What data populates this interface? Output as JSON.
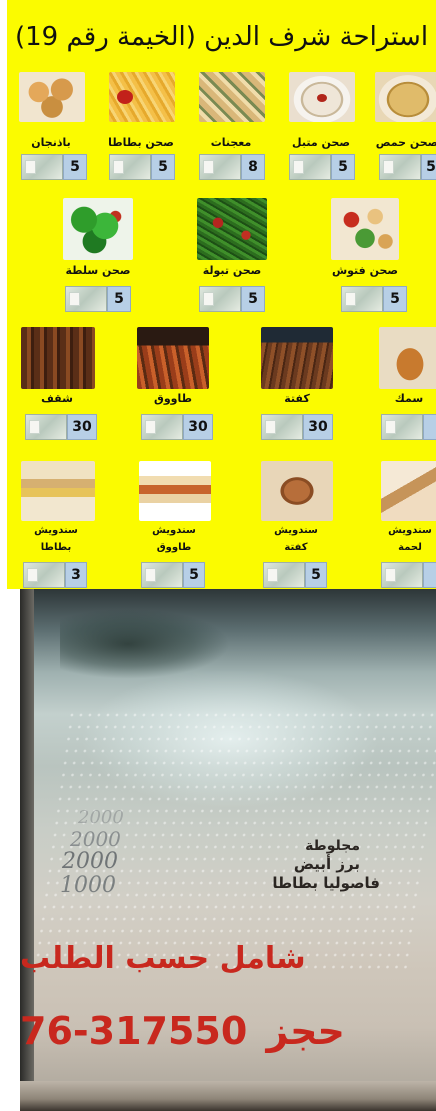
{
  "menu": {
    "title": "استراحة شرف الدين (الخيمة رقم 19)",
    "rows": [
      [
        {
          "label": "صحن حمص",
          "price": "5",
          "photo": "hummus"
        },
        {
          "label": "صحن متبل",
          "price": "5",
          "photo": "mutabal"
        },
        {
          "label": "معجنات",
          "price": "8",
          "photo": "pastry"
        },
        {
          "label": "صحن بطاطا",
          "price": "5",
          "photo": "fries"
        },
        {
          "label": "باذنجان",
          "price": "5",
          "photo": "bread"
        }
      ],
      [
        {
          "label": "صحن فتوش",
          "price": "5",
          "photo": "fattoush"
        },
        {
          "label": "صحن تبولة",
          "price": "5",
          "photo": "tabbouleh"
        },
        {
          "label": "صحن سلطة",
          "price": "5",
          "photo": "salad"
        }
      ],
      [
        {
          "label": "سمك",
          "price": "",
          "photo": "fish"
        },
        {
          "label": "كفتة",
          "price": "30",
          "photo": "grill3"
        },
        {
          "label": "طاووق",
          "price": "30",
          "photo": "grill2"
        },
        {
          "label": "شقف",
          "price": "30",
          "photo": "grill1"
        }
      ],
      [
        {
          "label": "سندويش",
          "label2": "لحمة",
          "price": "",
          "photo": "sand4"
        },
        {
          "label": "سندويش",
          "label2": "كفتة",
          "price": "5",
          "photo": "sand3"
        },
        {
          "label": "سندويش",
          "label2": "طاووق",
          "price": "5",
          "photo": "sand2"
        },
        {
          "label": "سندويش",
          "label2": "بطاطا",
          "price": "3",
          "photo": "sand1"
        }
      ]
    ]
  },
  "braille_sign": {
    "prices": [
      "2000",
      "2000",
      "2000",
      "1000"
    ],
    "items": [
      "مجلوطة",
      "برز أبيض",
      "فاصوليا بطاطا"
    ],
    "notice": "شامل حسب الطلب",
    "phone_label": "حجز",
    "phone": "76-317550"
  }
}
